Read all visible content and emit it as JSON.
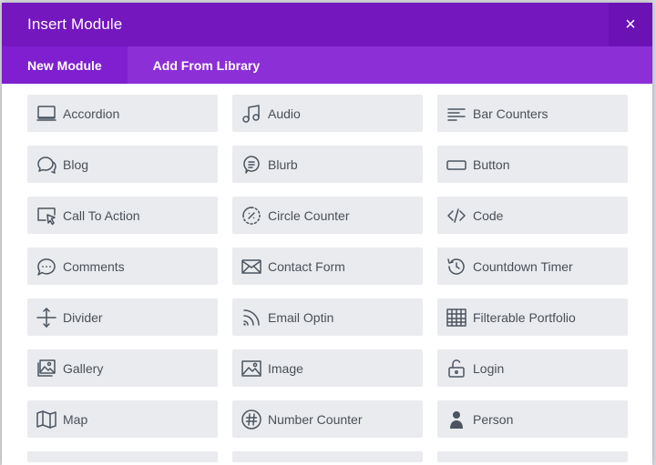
{
  "modal": {
    "title": "Insert Module",
    "close_symbol": "×"
  },
  "tabs": [
    {
      "label": "New Module",
      "active": true
    },
    {
      "label": "Add From Library",
      "active": false
    }
  ],
  "colors": {
    "header": "#7417bf",
    "tab_bar": "#8c2fd7",
    "tile_bg": "#e9ebee",
    "tile_text": "#4a5058"
  },
  "modules": [
    {
      "label": "Accordion",
      "icon": "accordion-icon"
    },
    {
      "label": "Audio",
      "icon": "audio-icon"
    },
    {
      "label": "Bar Counters",
      "icon": "bar-counters-icon"
    },
    {
      "label": "Blog",
      "icon": "blog-icon"
    },
    {
      "label": "Blurb",
      "icon": "blurb-icon"
    },
    {
      "label": "Button",
      "icon": "button-icon"
    },
    {
      "label": "Call To Action",
      "icon": "call-to-action-icon"
    },
    {
      "label": "Circle Counter",
      "icon": "circle-counter-icon"
    },
    {
      "label": "Code",
      "icon": "code-icon"
    },
    {
      "label": "Comments",
      "icon": "comments-icon"
    },
    {
      "label": "Contact Form",
      "icon": "contact-form-icon"
    },
    {
      "label": "Countdown Timer",
      "icon": "countdown-timer-icon"
    },
    {
      "label": "Divider",
      "icon": "divider-icon"
    },
    {
      "label": "Email Optin",
      "icon": "email-optin-icon"
    },
    {
      "label": "Filterable Portfolio",
      "icon": "filterable-portfolio-icon"
    },
    {
      "label": "Gallery",
      "icon": "gallery-icon"
    },
    {
      "label": "Image",
      "icon": "image-icon"
    },
    {
      "label": "Login",
      "icon": "login-icon"
    },
    {
      "label": "Map",
      "icon": "map-icon"
    },
    {
      "label": "Number Counter",
      "icon": "number-counter-icon"
    },
    {
      "label": "Person",
      "icon": "person-icon"
    }
  ]
}
